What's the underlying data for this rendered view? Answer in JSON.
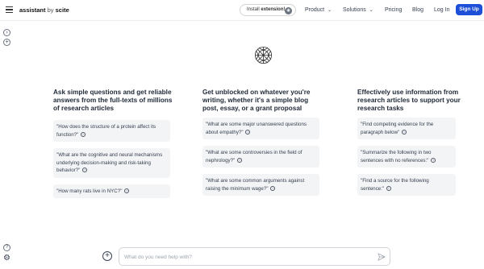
{
  "header": {
    "brand_name": "assistant",
    "brand_by": "by",
    "brand_org": "scite",
    "install_prefix": "Install",
    "install_bold": "extension!",
    "nav": {
      "product": "Product",
      "solutions": "Solutions",
      "pricing": "Pricing",
      "blog": "Blog",
      "login": "Log In",
      "signup": "Sign Up"
    }
  },
  "columns": [
    {
      "title": "Ask simple questions and get reliable answers from the full-texts of millions of research articles",
      "examples": [
        "\"How does the structure of a protein affect its function?\"",
        "\"What are the cognitive and neural mechanisms underlying decision-making and risk-taking behavior?\"",
        "\"How many rats live in NYC?\""
      ]
    },
    {
      "title": "Get unblocked on whatever you're writing, whether it's a simple blog post, essay, or a grant proposal",
      "examples": [
        "\"What are some major unanswered questions about empathy?\"",
        "\"What are some controversies in the field of nephrology?\"",
        "\"What are some common arguments against raising the minimum wage?\""
      ]
    },
    {
      "title": "Effectively use information from research articles to support your research tasks",
      "examples": [
        "\"Find competing evidence for the paragraph below\"",
        "\"Summarize the following in two sentences with no references:\"",
        "\"Find a source for the following sentence:\""
      ]
    }
  ],
  "prompt": {
    "placeholder": "What do you need help with?"
  },
  "colors": {
    "accent": "#1d4ed8",
    "card_bg": "#f3f4f6"
  },
  "icons": {
    "menu": "hamburger-icon",
    "new_chat": "arrow-right-circle-icon",
    "add": "plus-circle-icon",
    "help": "question-icon",
    "settings": "gear-icon",
    "send": "send-icon",
    "logo": "scite-logo-icon"
  }
}
